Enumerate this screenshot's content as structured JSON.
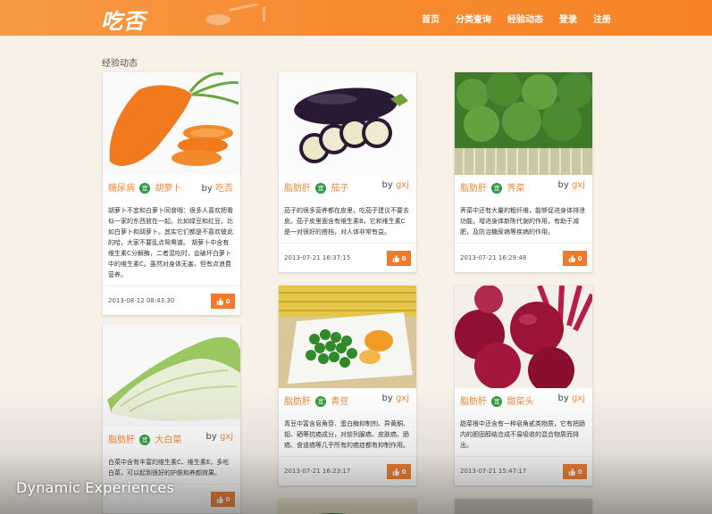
{
  "header": {
    "logo": "吃否",
    "nav": [
      "首页",
      "分类查询",
      "经验动态",
      "登录",
      "注册"
    ]
  },
  "section_title": "经验动态",
  "cards": [
    {
      "tag": "糖尿病",
      "badge": "宜",
      "veg": "胡萝卜",
      "by": "by",
      "author": "吃否",
      "desc": "胡萝卜不宜和白萝卜同食哦：很多人喜欢把看似一家的东西放在一起。比如绿豆和红豆，比如白萝卜和胡萝卜。其实它们都是不喜欢彼此的哈，大家不要乱点鸳鸯谱。 胡萝卜中含有维生素C分解酶，二者混吃时，会破坏白萝卜中的维生素C。虽然对身体无害，但有点浪费营养。",
      "time": "2013-08-12 08:43:30",
      "likes": "0"
    },
    {
      "tag": "脂肪肝",
      "badge": "宜",
      "veg": "茄子",
      "by": "by",
      "author": "gxj",
      "desc": "茄子的很多营养都在皮里，吃茄子建议不要去皮。茄子皮里面含有维生素B，它和维生素C是一对很好的搭档，对人体非常有益。",
      "time": "2013-07-21 16:37:15",
      "likes": "0"
    },
    {
      "tag": "脂肪肝",
      "badge": "宜",
      "veg": "荠菜",
      "by": "by",
      "author": "gxj",
      "desc": "荠菜中还有大量的粗纤维，能够促进身体排泄功能，增进身体新陈代谢的作用，有助于减肥，及防治糖尿病等疾病的作用。",
      "time": "2013-07-21 16:29:48",
      "likes": "0"
    },
    {
      "tag": "脂肪肝",
      "badge": "宜",
      "veg": "大白菜",
      "by": "by",
      "author": "gxj",
      "desc": "白菜中含有丰富的维生素C、维生素E，多吃白菜，可以起到很好的护肤和养颜效果。",
      "time": "",
      "likes": "0"
    },
    {
      "tag": "脂肪肝",
      "badge": "宜",
      "veg": "青豆",
      "by": "by",
      "author": "gxj",
      "desc": "青豆中富含皂角苷、蛋白酶抑制剂、异黄酮、钼、硒等抗癌成分，对前列腺癌、皮肤癌、肠癌、食道癌等几乎所有的癌症都有抑制作用。",
      "time": "2013-07-21 16:23:17",
      "likes": "0"
    },
    {
      "tag": "脂肪肝",
      "badge": "宜",
      "veg": "甜菜头",
      "by": "by",
      "author": "gxj",
      "desc": "甜菜根中还含有一种皂角甙类物质，它有把肠内的胆固醇结合成不易吸收的混合物质而排出。",
      "time": "2013-07-21 15:47:17",
      "likes": "0"
    }
  ],
  "watermark": "Dynamic Experiences",
  "colors": {
    "header": "#f78a30",
    "accent": "#f08b38",
    "badge": "#2e9c3e",
    "like": "#f07a2a"
  }
}
